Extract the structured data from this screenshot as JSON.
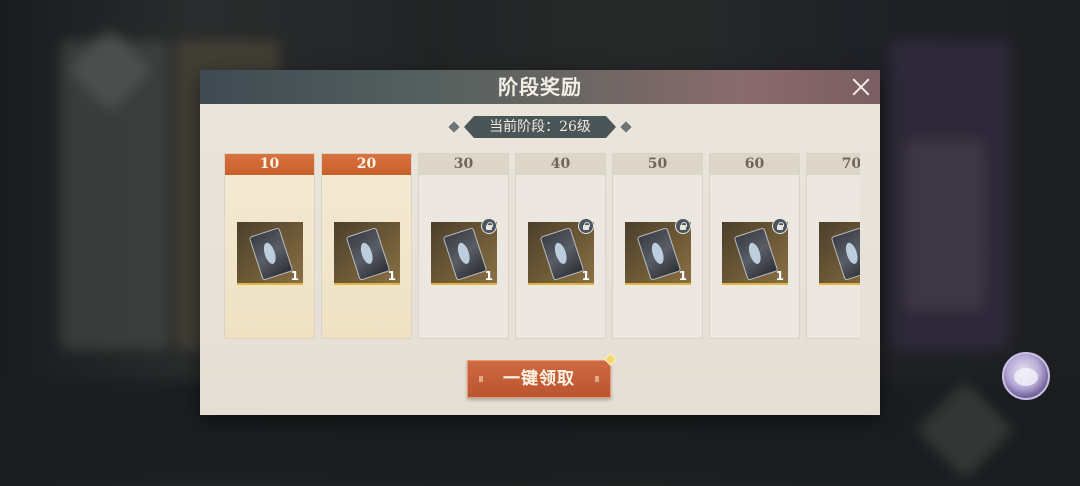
{
  "modal": {
    "title": "阶段奖励",
    "current_stage": "当前阶段：26级"
  },
  "rewards": [
    {
      "level": "10",
      "qty": "1",
      "claimed": true,
      "locked": false
    },
    {
      "level": "20",
      "qty": "1",
      "claimed": true,
      "locked": false
    },
    {
      "level": "30",
      "qty": "1",
      "claimed": false,
      "locked": true
    },
    {
      "level": "40",
      "qty": "1",
      "claimed": false,
      "locked": true
    },
    {
      "level": "50",
      "qty": "1",
      "claimed": false,
      "locked": true
    },
    {
      "level": "60",
      "qty": "1",
      "claimed": false,
      "locked": true
    },
    {
      "level": "70",
      "qty": "",
      "claimed": false,
      "locked": false
    }
  ],
  "actions": {
    "claim_all_label": "一键领取"
  },
  "icons": {
    "close": "close-icon",
    "lock": "lock-icon",
    "reward_item": "ticket-icon"
  },
  "colors": {
    "header_accent": "#c85d2c",
    "button": "#b8542f"
  }
}
